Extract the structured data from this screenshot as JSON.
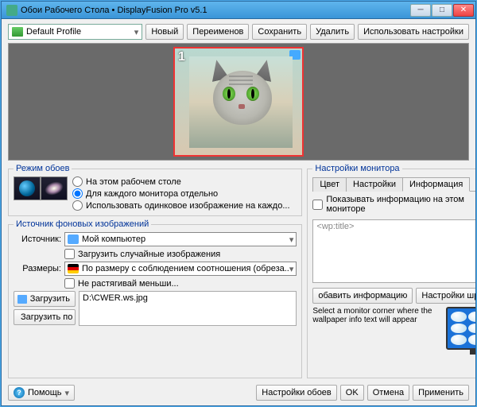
{
  "window": {
    "title": "Обои Рабочего Стола • DisplayFusion Pro v5.1"
  },
  "profile": {
    "selected": "Default Profile"
  },
  "topButtons": {
    "new": "Новый",
    "rename": "Переименов",
    "save": "Сохранить",
    "delete": "Удалить",
    "use": "Использовать настройки"
  },
  "preview": {
    "monitor_number": "1"
  },
  "mode": {
    "legend": "Режим обоев",
    "opt_this": "На этом рабочем столе",
    "opt_each": "Для каждого монитора отдельно",
    "opt_same": "Использовать одинковое изображение на каждо..."
  },
  "source": {
    "legend": "Источник фоновых изображений",
    "label_source": "Источник:",
    "source_value": "Мой компьютер",
    "chk_random": "Загрузить случайные изображения",
    "label_size": "Размеры:",
    "size_value": "По размеру с соблюдением соотношения (обреза..",
    "chk_nostretch": "Не растягивай меньши...",
    "btn_load": "Загрузить",
    "btn_loadby": "Загрузить по",
    "path": "D:\\CWER.ws.jpg"
  },
  "monitor": {
    "legend": "Настройки монитора",
    "tab_color": "Цвет",
    "tab_settings": "Настройки",
    "tab_info": "Информация",
    "chk_show": "Показывать информацию на этом мониторе",
    "placeholder": "<wp:title>",
    "btn_addinfo": "обавить информацию",
    "btn_font": "Настройки шрифта",
    "corner_text": "Select a monitor corner where the wallpaper info text will appear"
  },
  "bottom": {
    "help": "Помощь",
    "wallpaper_settings": "Настройки обоев",
    "ok": "OK",
    "cancel": "Отмена",
    "apply": "Применить"
  }
}
